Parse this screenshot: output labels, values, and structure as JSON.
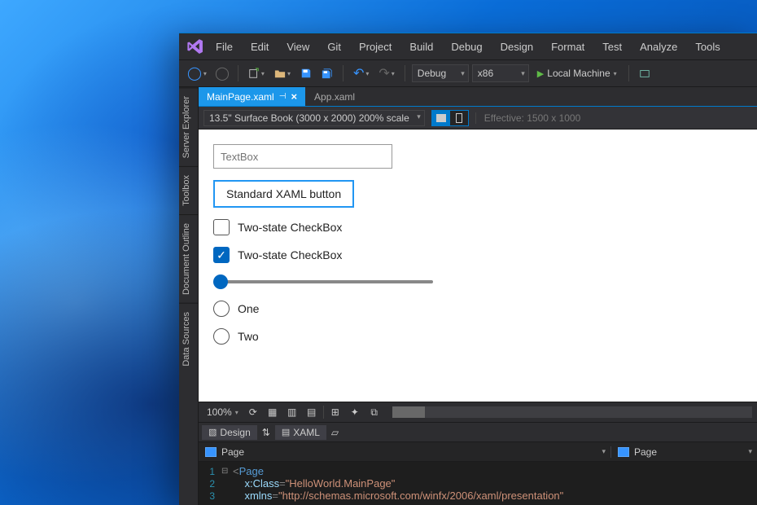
{
  "menu": [
    "File",
    "Edit",
    "View",
    "Git",
    "Project",
    "Build",
    "Debug",
    "Design",
    "Format",
    "Test",
    "Analyze",
    "Tools"
  ],
  "toolbar": {
    "config": "Debug",
    "platform": "x86",
    "run_target": "Local Machine"
  },
  "side_tabs": [
    "Server Explorer",
    "Toolbox",
    "Document Outline",
    "Data Sources"
  ],
  "doc_tabs": [
    {
      "label": "MainPage.xaml",
      "active": true,
      "pinned": true
    },
    {
      "label": "App.xaml",
      "active": false,
      "pinned": false
    }
  ],
  "designer": {
    "device": "13.5\" Surface Book (3000 x 2000) 200% scale",
    "effective": "Effective: 1500 x 1000"
  },
  "form": {
    "textbox_placeholder": "TextBox",
    "button_label": "Standard XAML button",
    "checkbox1_label": "Two-state CheckBox",
    "checkbox2_label": "Two-state CheckBox",
    "radio1_label": "One",
    "radio2_label": "Two"
  },
  "zoom": {
    "level": "100%"
  },
  "split": {
    "design_label": "Design",
    "xaml_label": "XAML"
  },
  "breadcrumb": {
    "left": "Page",
    "right": "Page"
  },
  "code": {
    "line1_open": "<",
    "line1_tag": "Page",
    "line2_attr": "x:Class",
    "line2_val": "\"HelloWorld.MainPage\"",
    "line3_attr": "xmlns",
    "line3_val": "\"http://schemas.microsoft.com/winfx/2006/xaml/presentation\""
  }
}
